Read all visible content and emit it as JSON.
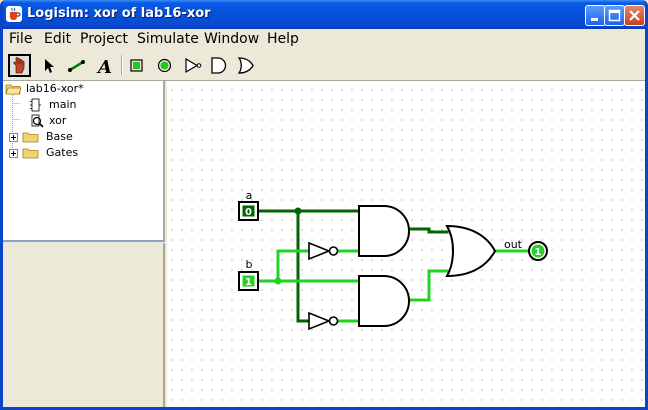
{
  "window": {
    "title": "Logisim: xor of lab16-xor",
    "controls": [
      "minimize-icon",
      "maximize-icon",
      "close-icon"
    ]
  },
  "menu": {
    "items": [
      {
        "label": "File"
      },
      {
        "label": "Edit"
      },
      {
        "label": "Project"
      },
      {
        "label": "Simulate"
      },
      {
        "label": "Window"
      },
      {
        "label": "Help"
      }
    ]
  },
  "toolbar": {
    "tools": [
      {
        "name": "poke-tool",
        "icon": "hand-icon",
        "selected": true
      },
      {
        "name": "select-tool",
        "icon": "arrow-icon"
      },
      {
        "name": "wiring-tool",
        "icon": "wire-icon"
      },
      {
        "name": "text-tool",
        "icon": "text-a-icon"
      },
      {
        "name": "input-pin-tool",
        "icon": "square-pin-icon"
      },
      {
        "name": "output-pin-tool",
        "icon": "round-pin-icon"
      },
      {
        "name": "not-gate-tool",
        "icon": "not-gate-icon"
      },
      {
        "name": "and-gate-tool",
        "icon": "and-gate-icon"
      },
      {
        "name": "or-gate-tool",
        "icon": "or-gate-icon"
      }
    ]
  },
  "explorer": {
    "project": "lab16-xor*",
    "circuits": [
      {
        "label": "main",
        "icon": "circuit-icon"
      },
      {
        "label": "xor",
        "icon": "circuit-magnify-icon"
      }
    ],
    "libraries": [
      {
        "label": "Base",
        "icon": "folder-icon"
      },
      {
        "label": "Gates",
        "icon": "folder-icon"
      }
    ]
  },
  "circuit": {
    "inputs": [
      {
        "label": "a",
        "value": "0"
      },
      {
        "label": "b",
        "value": "1"
      }
    ],
    "output": {
      "label": "out",
      "value": "1"
    },
    "colors": {
      "wire_high": "#22D322",
      "wire_low": "#006400",
      "gate": "#000000"
    }
  }
}
